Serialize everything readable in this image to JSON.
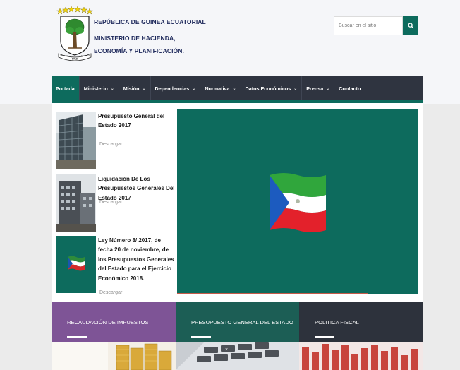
{
  "header": {
    "republic": "REPÚBLICA DE GUINEA ECUATORIAL",
    "ministry_line1": "MINISTERIO DE HACIENDA,",
    "ministry_line2": "ECONOMÍA  Y PLANIFICACIÓN.",
    "seal_motto": "PAZ",
    "seal_left": "UNIDAD",
    "seal_right": "JUSTICIA"
  },
  "search": {
    "placeholder": "Buscar en el sitio",
    "icon": "search-icon"
  },
  "nav": {
    "items": [
      {
        "label": "Portada",
        "active": true
      },
      {
        "label": "Ministerio"
      },
      {
        "label": "Misión"
      },
      {
        "label": "Dependencias"
      },
      {
        "label": "Normativa"
      },
      {
        "label": "Datos Económicos"
      },
      {
        "label": "Prensa"
      },
      {
        "label": "Contacto"
      }
    ]
  },
  "news": [
    {
      "title": "Presupuesto General del Estado 2017",
      "download": "Descargar"
    },
    {
      "title": "Liquidación De Los Presupuestos Generales Del Estado 2017",
      "download": "Descargar"
    },
    {
      "title": "Ley Número 8/ 2017, de fecha 20 de noviembre, de los Presupuestos Generales del Estado para el Ejercicio Económico 2018.",
      "download": "Descargar"
    }
  ],
  "panels": [
    {
      "label": "RECAUDACIÓN DE IMPUESTOS",
      "color": "#7e5496"
    },
    {
      "label": "PRESUPUESTO GENERAL DEL ESTADO",
      "color": "#1c5e55"
    },
    {
      "label": "POLITICA FISCAL",
      "color": "#2d323c"
    }
  ],
  "colors": {
    "accent": "#0d6b5d",
    "nav_bg": "#2f3440",
    "header_bg": "#f5f6f9",
    "progress": "#c65a4a"
  }
}
